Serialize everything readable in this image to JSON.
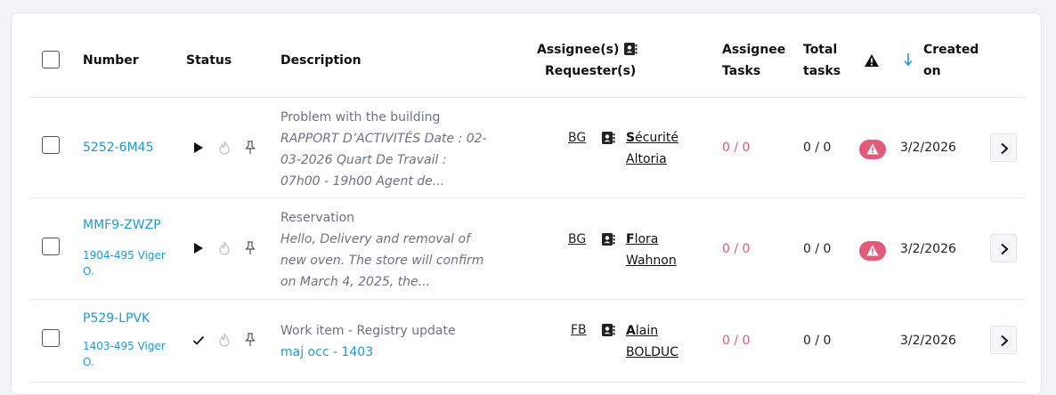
{
  "header": {
    "number": "Number",
    "status": "Status",
    "description": "Description",
    "assignees": "Assignee(s)",
    "requesters": "Requester(s)",
    "assignee_tasks_1": "Assignee",
    "assignee_tasks_2": "Tasks",
    "total_tasks_1": "Total",
    "total_tasks_2": "tasks",
    "created_1": "Created",
    "created_2": "on",
    "sort_direction": "descending"
  },
  "rows": [
    {
      "number": "5252-6M45",
      "location": "",
      "status_icon": "play-icon",
      "title": "Problem with the building",
      "detail": "RAPPORT D’ACTIVITÉS Date : 02-03-2026   Quart De Travail : 07h00 - 19h00     Agent de...",
      "assignee": "BG",
      "requester_initial": "S",
      "requester_rest": "écurité",
      "requester_line2": "Altoria",
      "assignee_tasks": "0 / 0",
      "total_tasks": "0 / 0",
      "alert": true,
      "created": "3/2/2026"
    },
    {
      "number": "MMF9-ZWZP",
      "location_1": "1904-495 Viger",
      "location_2": "O.",
      "status_icon": "play-icon",
      "title": "Reservation",
      "detail": "Hello,  Delivery and removal of new oven.  The store will confirm on March 4, 2025, the...",
      "assignee": "BG",
      "requester_initial": "F",
      "requester_rest": "lora",
      "requester_line2": "Wahnon",
      "assignee_tasks": "0 / 0",
      "total_tasks": "0 / 0",
      "alert": true,
      "created": "3/2/2026"
    },
    {
      "number": "P529-LPVK",
      "location_1": "1403-495 Viger",
      "location_2": "O.",
      "status_icon": "check-icon",
      "title": "Work item - Registry update",
      "detail_link": "maj occ - 1403",
      "assignee": "FB",
      "requester_initial": "A",
      "requester_rest": "lain",
      "requester_line2": "BOLDUC",
      "assignee_tasks": "0 / 0",
      "total_tasks": "0 / 0",
      "alert": false,
      "created": "3/2/2026"
    }
  ],
  "colors": {
    "link": "#1a9ad6",
    "tasks": "#dc5a7a",
    "alert_badge": "#e35b7b"
  }
}
